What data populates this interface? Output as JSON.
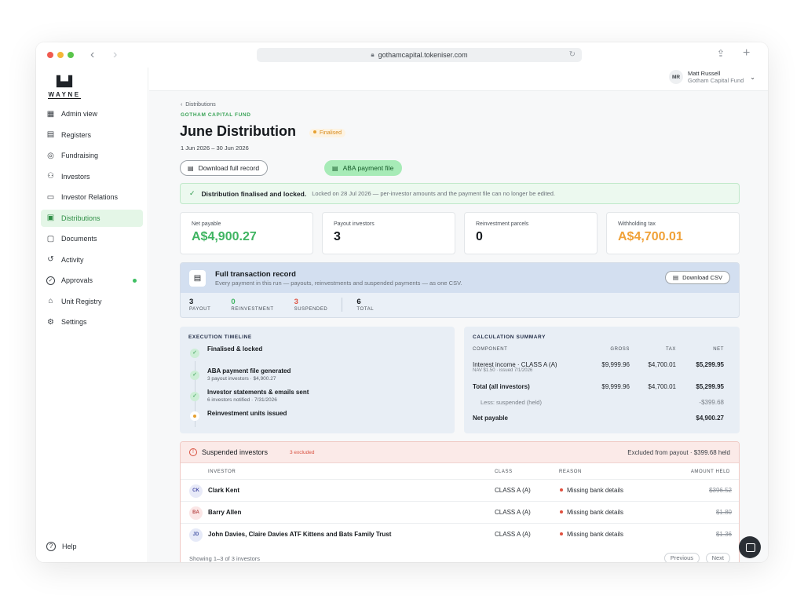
{
  "browser": {
    "url": "gothamcapital.tokeniser.com",
    "back_icon": "chevron-left-icon",
    "forward_icon": "chevron-right-icon"
  },
  "brand": {
    "word": "WAYNE"
  },
  "sidebar": {
    "items": [
      {
        "label": "Admin view",
        "icon": "grid-icon"
      },
      {
        "label": "Registers",
        "icon": "document-icon"
      },
      {
        "label": "Fundraising",
        "icon": "coins-icon"
      },
      {
        "label": "Investors",
        "icon": "users-icon"
      },
      {
        "label": "Investor Relations",
        "icon": "chat-icon"
      },
      {
        "label": "Distributions",
        "icon": "wallet-icon",
        "active": true
      },
      {
        "label": "Documents",
        "icon": "folder-icon"
      },
      {
        "label": "Activity",
        "icon": "history-icon"
      },
      {
        "label": "Approvals",
        "icon": "check-circle-icon",
        "badge": true
      },
      {
        "label": "Unit Registry",
        "icon": "building-icon"
      },
      {
        "label": "Settings",
        "icon": "gear-icon"
      }
    ],
    "help": "Help"
  },
  "user": {
    "initials": "MR",
    "name": "Matt Russell",
    "org": "Gotham Capital Fund"
  },
  "page": {
    "breadcrumb": "Distributions",
    "fund": "GOTHAM CAPITAL FUND",
    "title": "June Distribution",
    "status": "Finalised",
    "date_range": "1 Jun 2026 – 30 Jun 2026",
    "download_full_record": "Download full record",
    "aba_payment_file": "ABA payment file"
  },
  "banner": {
    "title": "Distribution finalised and locked.",
    "text": "Locked on 28 Jul 2026 — per-investor amounts and the payment file can no longer be edited."
  },
  "stats": [
    {
      "label": "Net payable",
      "value": "A$4,900.27",
      "tone": "green"
    },
    {
      "label": "Payout investors",
      "value": "3",
      "tone": "default"
    },
    {
      "label": "Reinvestment parcels",
      "value": "0",
      "tone": "default"
    },
    {
      "label": "Withholding tax",
      "value": "A$4,700.01",
      "tone": "orange"
    }
  ],
  "record": {
    "title": "Full transaction record",
    "subtitle": "Every payment in this run — payouts, reinvestments and suspended payments — as one CSV.",
    "download_csv": "Download CSV",
    "counts": [
      {
        "n": "3",
        "k": "PAYOUT",
        "tone": "default"
      },
      {
        "n": "0",
        "k": "REINVESTMENT",
        "tone": "green"
      },
      {
        "n": "3",
        "k": "SUSPENDED",
        "tone": "red"
      },
      {
        "n": "6",
        "k": "TOTAL",
        "tone": "default"
      }
    ]
  },
  "timeline": {
    "heading": "EXECUTION TIMELINE",
    "items": [
      {
        "title": "Finalised & locked",
        "sub": "",
        "done": true
      },
      {
        "title": "ABA payment file generated",
        "sub": "3 payout investors · $4,900.27",
        "done": true
      },
      {
        "title": "Investor statements & emails sent",
        "sub": "6 investors notified · 7/31/2026",
        "done": true
      },
      {
        "title": "Reinvestment units issued",
        "sub": "",
        "done": false
      }
    ]
  },
  "calc": {
    "heading": "CALCULATION SUMMARY",
    "columns": [
      "COMPONENT",
      "GROSS",
      "TAX",
      "NET"
    ],
    "rows": [
      {
        "component": "Interest income · CLASS A (A)",
        "note": "NAV $1.50 · issued 7/1/2026",
        "gross": "$9,999.96",
        "tax": "$4,700.01",
        "net": "$5,299.95"
      },
      {
        "component": "Total (all investors)",
        "gross": "$9,999.96",
        "tax": "$4,700.01",
        "net": "$5,299.95"
      },
      {
        "component": "Less: suspended (held)",
        "gross": "",
        "tax": "",
        "net": "-$399.68"
      },
      {
        "component": "Net payable",
        "gross": "",
        "tax": "",
        "net": "$4,900.27"
      }
    ]
  },
  "suspended": {
    "title": "Suspended investors",
    "excluded": "3 excluded",
    "summary": "Excluded from payout · $399.68 held",
    "columns": [
      "INVESTOR",
      "CLASS",
      "REASON",
      "AMOUNT HELD"
    ],
    "rows": [
      {
        "initials": "CK",
        "name": "Clark Kent",
        "class": "CLASS A (A)",
        "reason": "Missing bank details",
        "amount": "$396.52",
        "avatar_bg": "#e8eaf8",
        "avatar_fg": "#4a50a8"
      },
      {
        "initials": "BA",
        "name": "Barry Allen",
        "class": "CLASS A (A)",
        "reason": "Missing bank details",
        "amount": "$1.80",
        "avatar_bg": "#fbe6e6",
        "avatar_fg": "#b84a4a"
      },
      {
        "initials": "JD",
        "name": "John Davies, Claire Davies ATF Kittens and Bats Family Trust",
        "class": "CLASS A (A)",
        "reason": "Missing bank details",
        "amount": "$1.36",
        "avatar_bg": "#e6eaf8",
        "avatar_fg": "#4a5aa8"
      }
    ],
    "footer": "Showing 1–3 of 3 investors",
    "previous": "Previous",
    "next": "Next"
  }
}
